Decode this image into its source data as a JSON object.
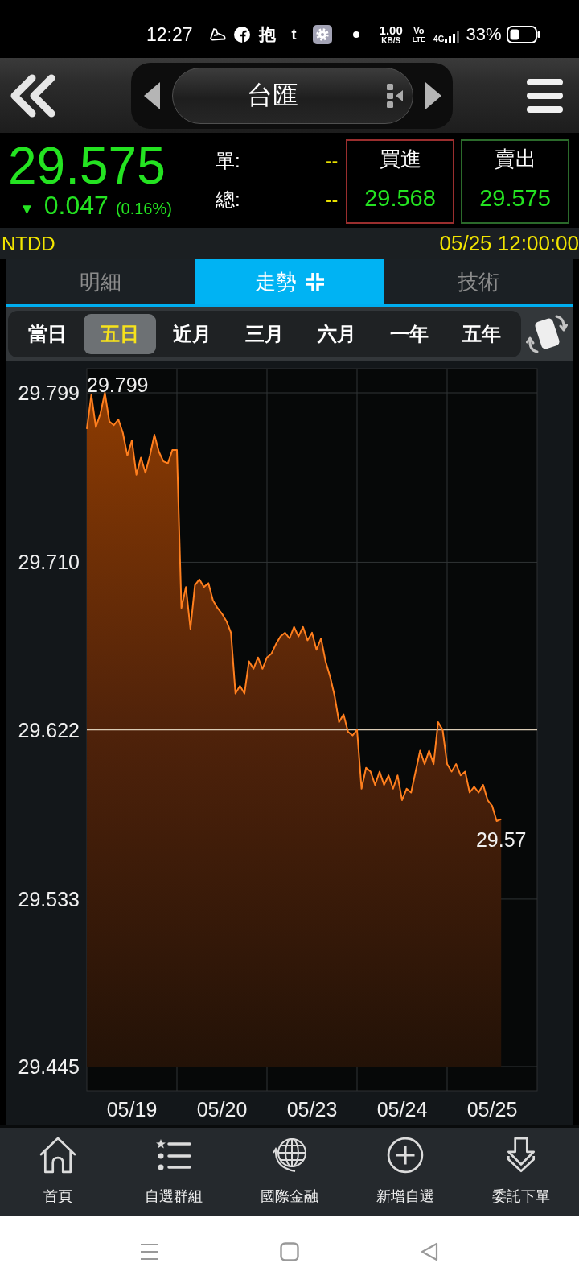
{
  "status_bar": {
    "time": "12:27",
    "notification_glyphs": [
      "抱",
      "t"
    ],
    "net_speed": {
      "value": "1.00",
      "unit": "KB/S"
    },
    "volte": {
      "top": "Vo",
      "bottom": "LTE"
    },
    "network": "4G",
    "battery": "33%"
  },
  "header": {
    "title": "台匯"
  },
  "quote": {
    "price": "29.575",
    "arrow": "▼",
    "change": "0.047",
    "change_pct": "(0.16%)",
    "stats": [
      {
        "label": "單:",
        "value": "--"
      },
      {
        "label": "總:",
        "value": "--"
      }
    ],
    "bid": {
      "label": "買進",
      "value": "29.568"
    },
    "ask": {
      "label": "賣出",
      "value": "29.575"
    }
  },
  "info": {
    "code": "NTDD",
    "timestamp": "05/25 12:00:00"
  },
  "tabs": [
    {
      "label": "明細",
      "selected": false
    },
    {
      "label": "走勢",
      "selected": true
    },
    {
      "label": "技術",
      "selected": false
    }
  ],
  "periods": [
    {
      "label": "當日",
      "selected": false
    },
    {
      "label": "五日",
      "selected": true
    },
    {
      "label": "近月",
      "selected": false
    },
    {
      "label": "三月",
      "selected": false
    },
    {
      "label": "六月",
      "selected": false
    },
    {
      "label": "一年",
      "selected": false
    },
    {
      "label": "五年",
      "selected": false
    }
  ],
  "chart": {
    "chart_data": {
      "type": "area",
      "categories": [
        null,
        null,
        null,
        null,
        null,
        null,
        null,
        null,
        null,
        null,
        "05/19",
        null,
        null,
        null,
        null,
        null,
        null,
        null,
        null,
        null,
        null,
        null,
        null,
        null,
        null,
        null,
        null,
        null,
        null,
        null,
        "05/20",
        null,
        null,
        null,
        null,
        null,
        null,
        null,
        null,
        null,
        null,
        null,
        null,
        null,
        null,
        null,
        null,
        null,
        null,
        null,
        "05/23",
        null,
        null,
        null,
        null,
        null,
        null,
        null,
        null,
        null,
        null,
        null,
        null,
        null,
        null,
        null,
        null,
        null,
        null,
        null,
        "05/24",
        null,
        null,
        null,
        null,
        null,
        null,
        null,
        null,
        null,
        null,
        null,
        null,
        null,
        null,
        null,
        null,
        null,
        null,
        null,
        "05/25",
        null,
        null
      ],
      "series": [
        {
          "color": "#ff7f1e",
          "values": [
            29.78,
            29.798,
            29.781,
            29.788,
            29.799,
            29.784,
            29.782,
            29.785,
            29.778,
            29.766,
            29.774,
            29.756,
            29.765,
            29.757,
            29.766,
            29.777,
            29.768,
            29.763,
            29.762,
            29.769,
            29.769,
            29.686,
            29.697,
            29.675,
            29.698,
            29.701,
            29.697,
            29.699,
            29.69,
            29.686,
            29.683,
            29.679,
            29.673,
            29.641,
            29.645,
            29.641,
            29.658,
            29.654,
            29.66,
            29.654,
            29.66,
            29.662,
            29.667,
            29.671,
            29.673,
            29.67,
            29.676,
            29.671,
            29.676,
            29.669,
            29.673,
            29.664,
            29.67,
            29.658,
            29.65,
            29.64,
            29.626,
            29.63,
            29.621,
            29.619,
            29.622,
            29.591,
            29.602,
            29.6,
            29.593,
            29.6,
            29.593,
            29.598,
            29.591,
            29.598,
            29.585,
            29.591,
            29.589,
            29.6,
            29.611,
            29.604,
            29.611,
            29.604,
            29.626,
            29.622,
            29.604,
            29.6,
            29.604,
            29.598,
            29.6,
            29.589,
            29.592,
            29.589,
            29.593,
            29.585,
            29.582,
            29.574,
            29.575
          ]
        }
      ],
      "ylim": [
        29.445,
        29.799
      ],
      "yticks": [
        29.445,
        29.533,
        29.622,
        {
          "value": 29.71,
          "label": "29.710"
        },
        29.799
      ],
      "ref_lines": [
        {
          "axis": "y",
          "value": 29.622
        }
      ],
      "annotations": [
        "29.799",
        "29.57"
      ]
    }
  },
  "bottom_nav": [
    {
      "kind": "home",
      "label": "首頁"
    },
    {
      "kind": "list",
      "label": "自選群組"
    },
    {
      "kind": "globe",
      "label": "國際金融"
    },
    {
      "kind": "add",
      "label": "新增自選"
    },
    {
      "kind": "order",
      "label": "委託下單"
    }
  ]
}
